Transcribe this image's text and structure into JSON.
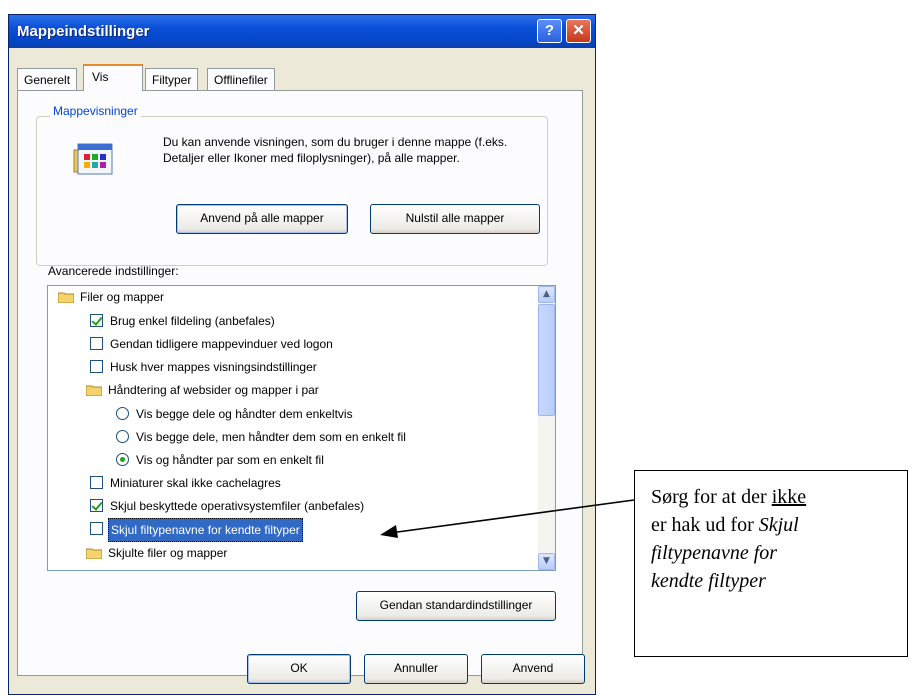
{
  "window": {
    "title": "Mappeindstillinger",
    "help_label": "?",
    "close_label": "✕"
  },
  "tabs": [
    "Generelt",
    "Vis",
    "Filtyper",
    "Offlinefiler"
  ],
  "folder_views": {
    "label": "Mappevisninger",
    "text": "Du kan anvende visningen, som du bruger i denne mappe (f.eks. Detaljer eller Ikoner med filoplysninger), på alle mapper.",
    "apply_all_label": "Anvend på alle mapper",
    "reset_all_label": "Nulstil alle mapper"
  },
  "advanced": {
    "label": "Avancerede indstillinger:",
    "items": [
      {
        "type": "folder",
        "text": "Filer og mapper"
      },
      {
        "type": "checkbox",
        "checked": true,
        "text": "Brug enkel fildeling (anbefales)"
      },
      {
        "type": "checkbox",
        "checked": false,
        "text": "Gendan tidligere mappevinduer ved logon"
      },
      {
        "type": "checkbox",
        "checked": false,
        "text": "Husk hver mappes visningsindstillinger"
      },
      {
        "type": "folder",
        "text": "Håndtering af websider og mapper i par"
      },
      {
        "type": "radio",
        "checked": false,
        "text": "Vis begge dele og håndter dem enkeltvis"
      },
      {
        "type": "radio",
        "checked": false,
        "text": "Vis begge dele, men håndter dem som en enkelt fil"
      },
      {
        "type": "radio",
        "checked": true,
        "text": "Vis og håndter par som en enkelt fil"
      },
      {
        "type": "checkbox",
        "checked": false,
        "text": "Miniaturer skal ikke cachelagres"
      },
      {
        "type": "checkbox",
        "checked": true,
        "text": "Skjul beskyttede operativsystemfiler (anbefales)"
      },
      {
        "type": "checkbox",
        "checked": false,
        "text": "Skjul filtypenavne for kendte filtyper",
        "selected": true
      },
      {
        "type": "folder",
        "text": "Skjulte filer og mapper"
      }
    ],
    "restore_label": "Gendan standardindstillinger"
  },
  "footer": {
    "ok_label": "OK",
    "cancel_label": "Annuller",
    "apply_label": "Anvend"
  },
  "callout": {
    "line1_pre": "Sørg for at der ",
    "line1_underline": "ikke",
    "line2_pre": "er hak ud for ",
    "line2_italic": "Skjul",
    "line3_italic": "filtypenavne for",
    "line4_italic": "kendte filtyper"
  },
  "colors": {
    "title_bar": "#0a50d8",
    "selection": "#316ac5",
    "check": "#21a121"
  }
}
